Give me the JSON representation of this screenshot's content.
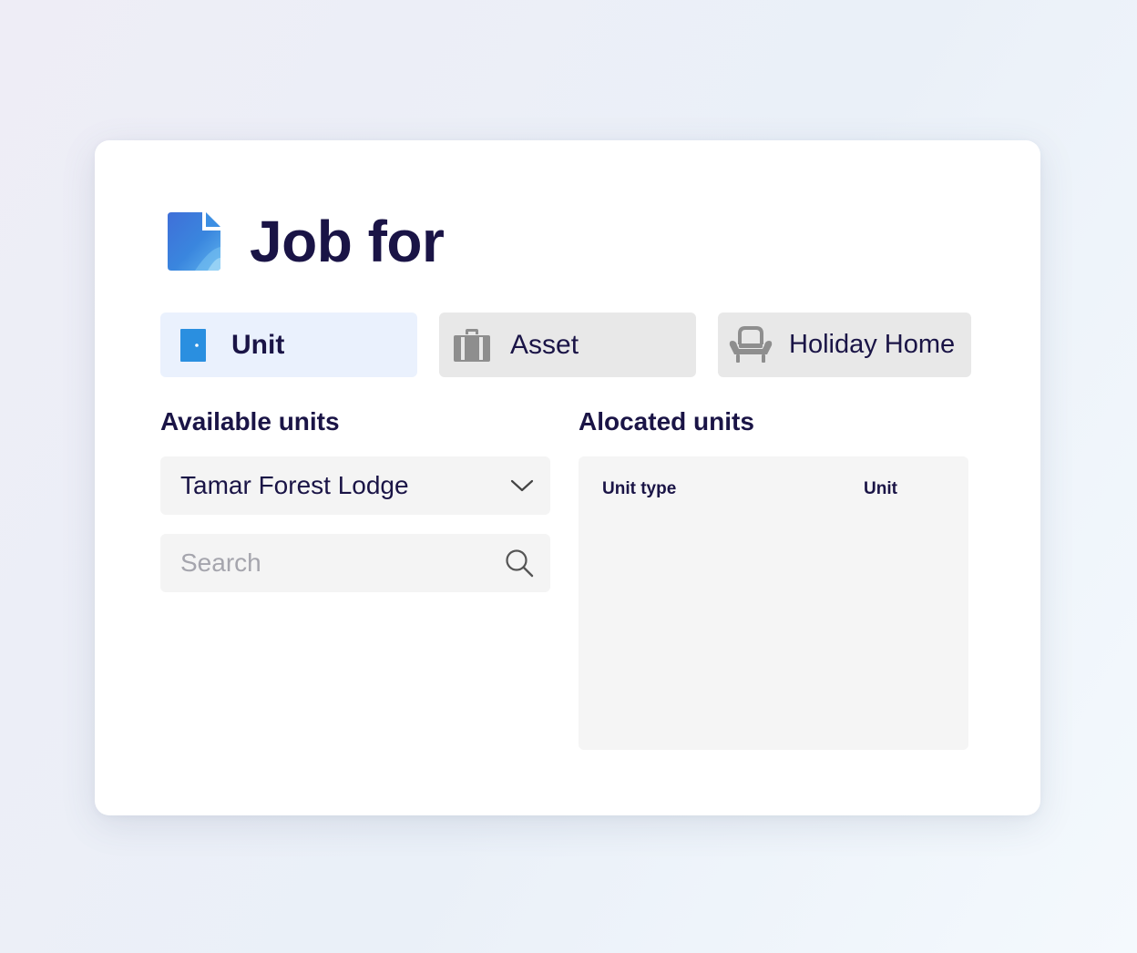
{
  "header": {
    "title": "Job for",
    "icon": "document-icon"
  },
  "tabs": [
    {
      "label": "Unit",
      "icon": "door-icon",
      "active": true
    },
    {
      "label": "Asset",
      "icon": "luggage-icon",
      "active": false
    },
    {
      "label": "Holiday Home",
      "icon": "armchair-icon",
      "active": false
    }
  ],
  "available": {
    "title": "Available units",
    "selected_location": "Tamar Forest Lodge",
    "search_placeholder": "Search"
  },
  "allocated": {
    "title": "Alocated units",
    "columns": [
      "Unit type",
      "Unit"
    ]
  },
  "colors": {
    "title_text": "#1a1446",
    "active_tab_bg": "#eaf1fd",
    "inactive_tab_bg": "#e8e8e8",
    "accent_blue": "#2a8fe0",
    "icon_gray": "#8e8e8e",
    "field_bg": "#f4f4f4"
  }
}
